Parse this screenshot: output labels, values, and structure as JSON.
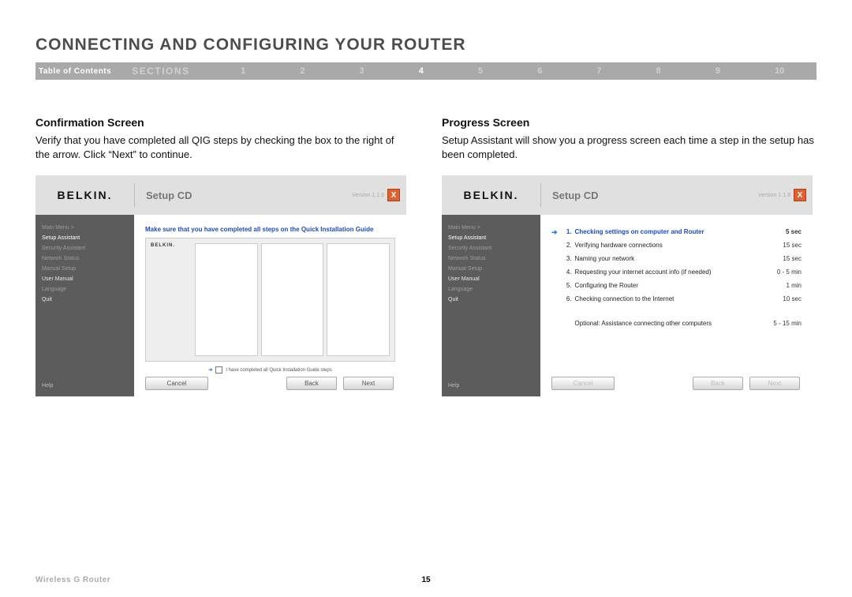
{
  "page": {
    "title": "CONNECTING AND CONFIGURING YOUR ROUTER",
    "toc_label": "Table of Contents",
    "sections_label": "SECTIONS",
    "numbers": [
      "1",
      "2",
      "3",
      "4",
      "5",
      "6",
      "7",
      "8",
      "9",
      "10"
    ],
    "active_section": "4",
    "product": "Wireless G Router",
    "page_number": "15"
  },
  "left": {
    "heading": "Confirmation Screen",
    "body": "Verify that you have completed all QIG steps by checking the box to the right of the arrow. Click “Next” to continue."
  },
  "right": {
    "heading": "Progress Screen",
    "body": "Setup Assistant will show you a progress screen each time a step in the setup has been completed."
  },
  "shot_common": {
    "logo": "BELKIN.",
    "setup_cd": "Setup CD",
    "version": "Version 1.1.8",
    "close": "X",
    "sidebar": {
      "items": [
        "Main Menu  >",
        "Setup Assistant",
        "Security Assistant",
        "Network Status",
        "Manual Setup",
        "User Manual",
        "Language",
        "Quit"
      ],
      "help": "Help"
    },
    "buttons": {
      "cancel": "Cancel",
      "back": "Back",
      "next": "Next"
    }
  },
  "shot_left": {
    "instruction": "Make sure that you have completed all steps on the Quick Installation Guide",
    "check_label": "I have completed all Quick Installation Guide steps"
  },
  "shot_right": {
    "steps": [
      {
        "n": "1.",
        "t": "Checking settings on computer and Router",
        "d": "5 sec",
        "active": true
      },
      {
        "n": "2.",
        "t": "Verifying hardware connections",
        "d": "15 sec"
      },
      {
        "n": "3.",
        "t": "Naming your network",
        "d": "15 sec"
      },
      {
        "n": "4.",
        "t": "Requesting your internet account info (if needed)",
        "d": "0 - 5 min"
      },
      {
        "n": "5.",
        "t": "Configuring the Router",
        "d": "1 min"
      },
      {
        "n": "6.",
        "t": "Checking connection to the Internet",
        "d": "10 sec"
      }
    ],
    "optional": {
      "t": "Optional: Assistance connecting other computers",
      "d": "5 - 15 min"
    }
  }
}
